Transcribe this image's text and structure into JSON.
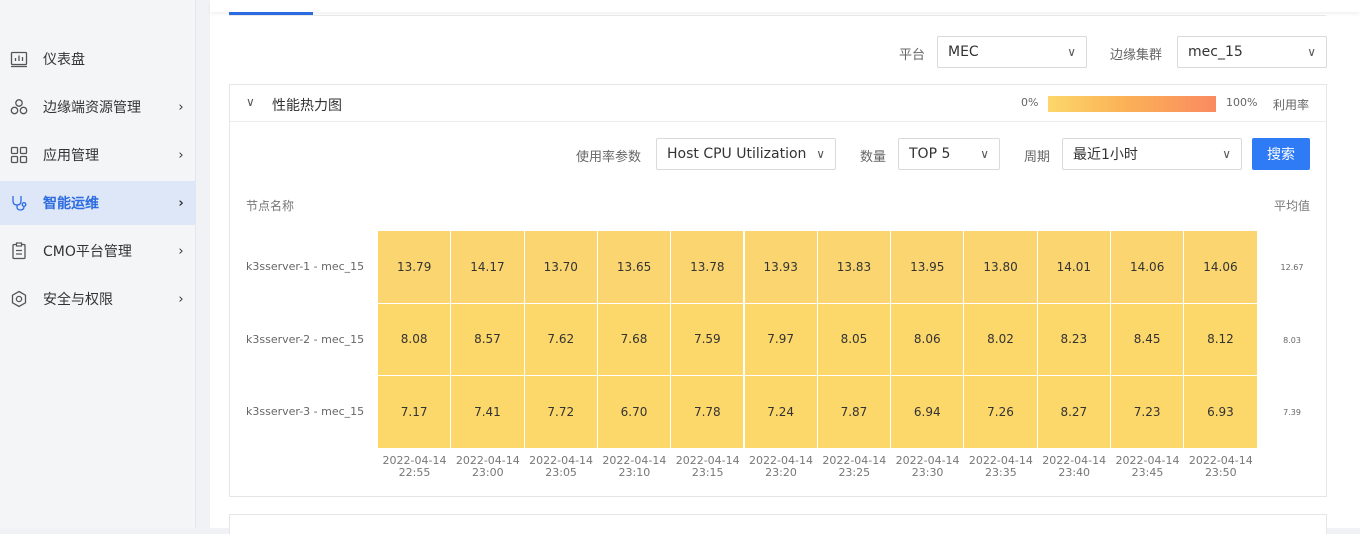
{
  "sidebar": {
    "items": [
      {
        "label": "仪表盘",
        "icon": "chart-icon",
        "has_children": false,
        "active": false
      },
      {
        "label": "边缘端资源管理",
        "icon": "nodes-icon",
        "has_children": true,
        "active": false
      },
      {
        "label": "应用管理",
        "icon": "apps-grid-icon",
        "has_children": true,
        "active": false
      },
      {
        "label": "智能运维",
        "icon": "stethoscope-icon",
        "has_children": true,
        "active": true
      },
      {
        "label": "CMO平台管理",
        "icon": "clipboard-icon",
        "has_children": true,
        "active": false
      },
      {
        "label": "安全与权限",
        "icon": "gear-icon",
        "has_children": true,
        "active": false
      }
    ]
  },
  "filters": {
    "platform_label": "平台",
    "platform_value": "MEC",
    "cluster_label": "边缘集群",
    "cluster_value": "mec_15"
  },
  "panel": {
    "title": "性能热力图",
    "legend_min": "0%",
    "legend_max": "100%",
    "legend_label": "利用率",
    "metric_label": "使用率参数",
    "metric_value": "Host CPU Utilization",
    "count_label": "数量",
    "count_value": "TOP 5",
    "period_label": "周期",
    "period_value": "最近1小时",
    "search_button": "搜索",
    "node_header": "节点名称",
    "avg_header": "平均值"
  },
  "heatmap": {
    "rows": [
      {
        "name": "k3sserver-1 - mec_15",
        "avg": "12.67",
        "values": [
          "13.79",
          "14.17",
          "13.70",
          "13.65",
          "13.78",
          "13.93",
          "13.83",
          "13.95",
          "13.80",
          "14.01",
          "14.06",
          "14.06"
        ]
      },
      {
        "name": "k3sserver-2 - mec_15",
        "avg": "8.03",
        "values": [
          "8.08",
          "8.57",
          "7.62",
          "7.68",
          "7.59",
          "7.97",
          "8.05",
          "8.06",
          "8.02",
          "8.23",
          "8.45",
          "8.12"
        ]
      },
      {
        "name": "k3sserver-3 - mec_15",
        "avg": "7.39",
        "values": [
          "7.17",
          "7.41",
          "7.72",
          "6.70",
          "7.78",
          "7.24",
          "7.87",
          "6.94",
          "7.26",
          "8.27",
          "7.23",
          "6.93"
        ]
      }
    ],
    "times": [
      [
        "2022-04-14",
        "22:55"
      ],
      [
        "2022-04-14",
        "23:00"
      ],
      [
        "2022-04-14",
        "23:05"
      ],
      [
        "2022-04-14",
        "23:10"
      ],
      [
        "2022-04-14",
        "23:15"
      ],
      [
        "2022-04-14",
        "23:20"
      ],
      [
        "2022-04-14",
        "23:25"
      ],
      [
        "2022-04-14",
        "23:30"
      ],
      [
        "2022-04-14",
        "23:35"
      ],
      [
        "2022-04-14",
        "23:40"
      ],
      [
        "2022-04-14",
        "23:45"
      ],
      [
        "2022-04-14",
        "23:50"
      ]
    ],
    "cell_color": "#fcd76a",
    "cell_color_high": "#fbd670"
  },
  "colors": {
    "accent": "#2d6be0",
    "button": "#2f7bf5"
  }
}
